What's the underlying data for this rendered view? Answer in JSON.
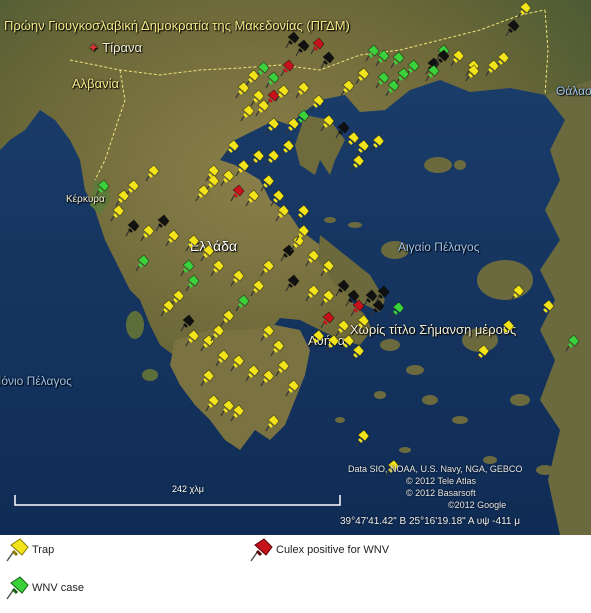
{
  "map": {
    "labels": {
      "fyrom": "Πρώην Γιουγκοσλαβική Δημοκρατία της Μακεδονίας (ΠΓΔΜ)",
      "tirana": "Τίρανα",
      "albania": "Αλβανία",
      "kerkyra": "Κέρκυρα",
      "ellada": "Ελλάδα",
      "aegean": "Αιγαίο Πέλαγος",
      "athens": "Αθήνα",
      "untitled_place": "Χωρίς τίτλο Σήμανση μέρους",
      "ionian": "Ιόνιο Πέλαγος",
      "thessaloniki_sea": "Θάλασ"
    },
    "attribution": [
      "Data SIO, NOAA, U.S. Navy, NGA, GEBCO",
      "© 2012 Tele Atlas",
      "© 2012 Basarsoft",
      "©2012 Google"
    ],
    "coordinates": "39°47'41.42\" Β 25°16'19.18\" Α υψ -411 μ",
    "scale_label": "242 χλμ",
    "colors": {
      "trap": "#f2e31b",
      "wnv_case": "#3bd13b",
      "culex_positive": "#c8121b",
      "other": "#111111",
      "sea": "#14345f",
      "land": "#6e6a3c"
    }
  },
  "legend": {
    "trap": "Trap",
    "culex_positive": "Culex positive for WNV",
    "wnv_case": "WNV case"
  }
}
